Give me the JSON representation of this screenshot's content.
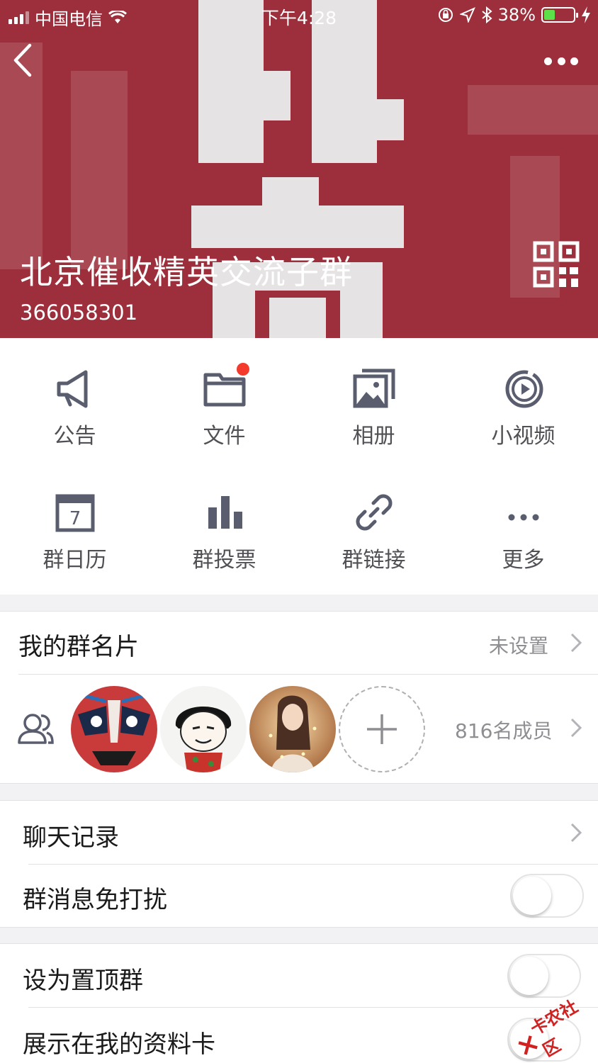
{
  "status_bar": {
    "carrier": "中国电信",
    "time": "下午4:28",
    "battery_text": "38%",
    "battery_level": 0.38
  },
  "header": {
    "group_name": "北京催收精英交流子群",
    "group_id": "366058301",
    "background_color": "#9c2f3b"
  },
  "tools": [
    {
      "label": "公告",
      "icon": "megaphone-icon"
    },
    {
      "label": "文件",
      "icon": "folder-icon",
      "badge": true
    },
    {
      "label": "相册",
      "icon": "album-icon"
    },
    {
      "label": "小视频",
      "icon": "video-icon"
    },
    {
      "label": "群日历",
      "icon": "calendar-icon",
      "calendar_day": "7"
    },
    {
      "label": "群投票",
      "icon": "bar-chart-icon"
    },
    {
      "label": "群链接",
      "icon": "link-icon"
    },
    {
      "label": "更多",
      "icon": "more-dots-icon"
    }
  ],
  "card": {
    "title": "我的群名片",
    "value": "未设置"
  },
  "members": {
    "count_label": "816名成员"
  },
  "settings": [
    {
      "label": "聊天记录",
      "type": "link"
    },
    {
      "label": "群消息免打扰",
      "type": "toggle",
      "on": false
    },
    {
      "label": "设为置顶群",
      "type": "toggle",
      "on": false
    },
    {
      "label": "展示在我的资料卡",
      "type": "toggle",
      "on": false
    }
  ],
  "watermark": {
    "text": "卡农社区"
  }
}
